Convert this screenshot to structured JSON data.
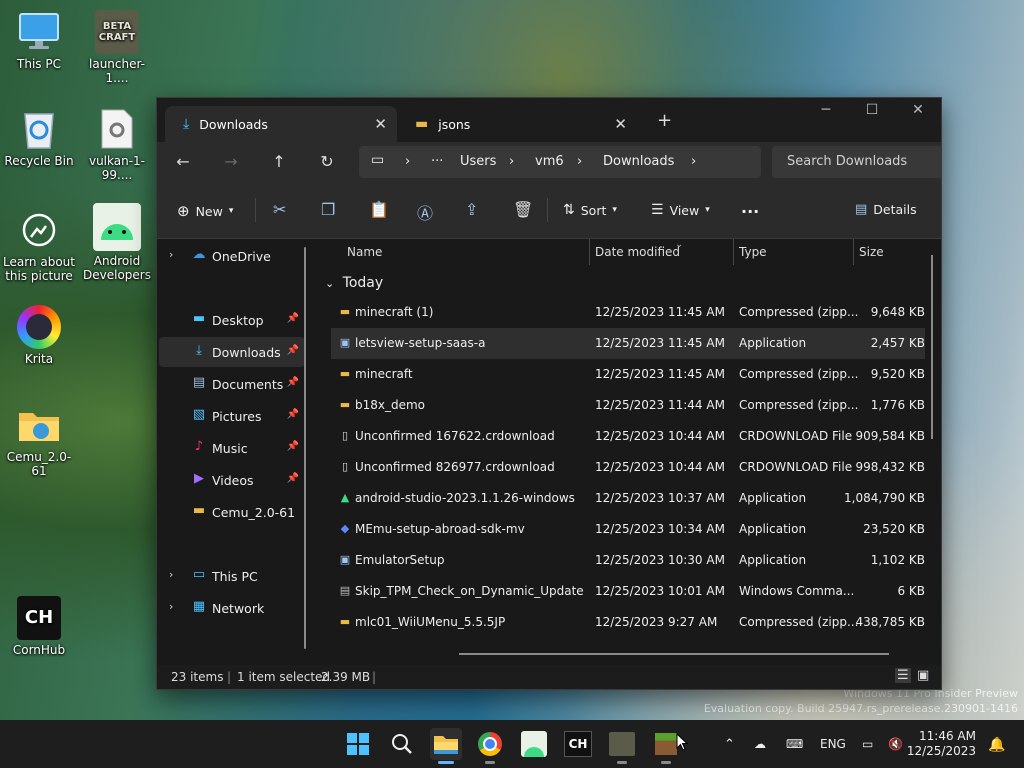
{
  "desktop": {
    "icons": [
      {
        "label": "This PC"
      },
      {
        "label": "launcher-1...."
      },
      {
        "label": "Recycle Bin"
      },
      {
        "label": "vulkan-1-99...."
      },
      {
        "label": "Learn about this picture"
      },
      {
        "label": "Android Developers"
      },
      {
        "label": "Krita"
      },
      {
        "label": "Cemu_2.0-61"
      },
      {
        "label": "CornHub"
      }
    ],
    "beta_craft_logo": "BETA CRAFT",
    "cornhub_logo": "CH",
    "watermark_line1": "Windows 11 Pro Insider Preview",
    "watermark_line2": "Evaluation copy. Build 25947.rs_prerelease.230901-1416"
  },
  "explorer": {
    "tabs": [
      {
        "label": "Downloads",
        "active": true,
        "icon": "download-icon"
      },
      {
        "label": "jsons",
        "active": false,
        "icon": "folder-icon"
      }
    ],
    "breadcrumb": [
      "Users",
      "vm6",
      "Downloads"
    ],
    "search_placeholder": "Search Downloads",
    "commands": {
      "new_label": "New",
      "sort_label": "Sort",
      "view_label": "View",
      "details_label": "Details"
    },
    "nav": [
      {
        "label": "OneDrive"
      },
      {
        "label": "Desktop"
      },
      {
        "label": "Downloads"
      },
      {
        "label": "Documents"
      },
      {
        "label": "Pictures"
      },
      {
        "label": "Music"
      },
      {
        "label": "Videos"
      },
      {
        "label": "Cemu_2.0-61"
      },
      {
        "label": "This PC"
      },
      {
        "label": "Network"
      }
    ],
    "columns": {
      "name": "Name",
      "date": "Date modified",
      "type": "Type",
      "size": "Size"
    },
    "group_label": "Today",
    "files": [
      {
        "name": "minecraft (1)",
        "date": "12/25/2023 11:45 AM",
        "type": "Compressed (zipp...",
        "size": "9,648 KB",
        "icon": "zip-folder-icon"
      },
      {
        "name": "letsview-setup-saas-a",
        "date": "12/25/2023 11:45 AM",
        "type": "Application",
        "size": "2,457 KB",
        "icon": "app-icon"
      },
      {
        "name": "minecraft",
        "date": "12/25/2023 11:45 AM",
        "type": "Compressed (zipp...",
        "size": "9,520 KB",
        "icon": "zip-folder-icon"
      },
      {
        "name": "b18x_demo",
        "date": "12/25/2023 11:44 AM",
        "type": "Compressed (zipp...",
        "size": "1,776 KB",
        "icon": "zip-folder-icon"
      },
      {
        "name": "Unconfirmed 167622.crdownload",
        "date": "12/25/2023 10:44 AM",
        "type": "CRDOWNLOAD File",
        "size": "909,584 KB",
        "icon": "file-icon"
      },
      {
        "name": "Unconfirmed 826977.crdownload",
        "date": "12/25/2023 10:44 AM",
        "type": "CRDOWNLOAD File",
        "size": "998,432 KB",
        "icon": "file-icon"
      },
      {
        "name": "android-studio-2023.1.1.26-windows",
        "date": "12/25/2023 10:37 AM",
        "type": "Application",
        "size": "1,084,790 KB",
        "icon": "android-icon"
      },
      {
        "name": "MEmu-setup-abroad-sdk-mv",
        "date": "12/25/2023 10:34 AM",
        "type": "Application",
        "size": "23,520 KB",
        "icon": "memu-icon"
      },
      {
        "name": "EmulatorSetup",
        "date": "12/25/2023 10:30 AM",
        "type": "Application",
        "size": "1,102 KB",
        "icon": "app-icon"
      },
      {
        "name": "Skip_TPM_Check_on_Dynamic_Update",
        "date": "12/25/2023 10:01 AM",
        "type": "Windows Comma...",
        "size": "6 KB",
        "icon": "script-icon"
      },
      {
        "name": "mlc01_WiiUMenu_5.5.5JP",
        "date": "12/25/2023 9:27 AM",
        "type": "Compressed (zipp...",
        "size": "438,785 KB",
        "icon": "zip-folder-icon"
      }
    ],
    "status": {
      "count": "23 items",
      "selected": "1 item selected",
      "size": "2.39 MB"
    }
  },
  "taskbar": {
    "lang": "ENG",
    "time": "11:46 AM",
    "date": "12/25/2023",
    "cornhub_label": "CH"
  },
  "colors": {
    "accent": "#4cc2ff",
    "folder": "#e8b84a",
    "window_bg": "#202020"
  }
}
